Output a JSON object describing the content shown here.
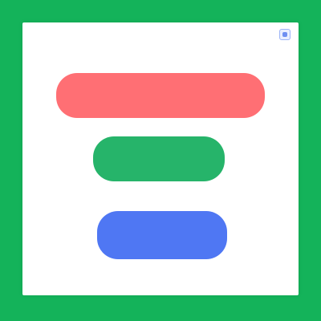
{
  "header": {
    "title": "",
    "icon": "window-icon"
  },
  "buttons": {
    "red_label": "",
    "green_label": "",
    "blue_label": ""
  },
  "colors": {
    "frame": "#14b35a",
    "panel": "#ffffff",
    "red_button": "#ff6f74",
    "green_button": "#26b46a",
    "blue_button": "#4f77f3",
    "header_text": "#2f8f61"
  }
}
